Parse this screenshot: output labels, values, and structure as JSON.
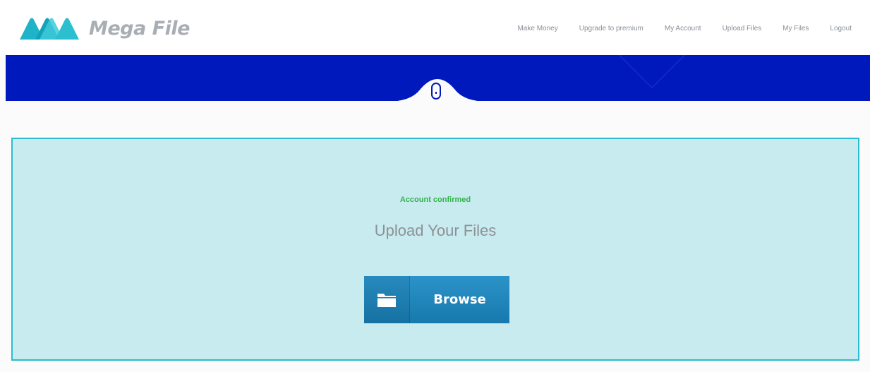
{
  "brand": {
    "name": "Mega File",
    "accent": "#0019bd",
    "logo_colors": [
      "#1fb3c7",
      "#3ecad9"
    ]
  },
  "nav": {
    "items": [
      {
        "label": "Make Money"
      },
      {
        "label": "Upgrade to premium"
      },
      {
        "label": "My Account"
      },
      {
        "label": "Upload Files"
      },
      {
        "label": "My Files"
      },
      {
        "label": "Logout"
      }
    ]
  },
  "hero": {
    "scroll_icon": "mouse-scroll-icon"
  },
  "upload": {
    "status": "Account confirmed",
    "status_color": "#32b34a",
    "title": "Upload Your Files",
    "browse_label": "Browse",
    "browse_icon": "folder-icon"
  }
}
